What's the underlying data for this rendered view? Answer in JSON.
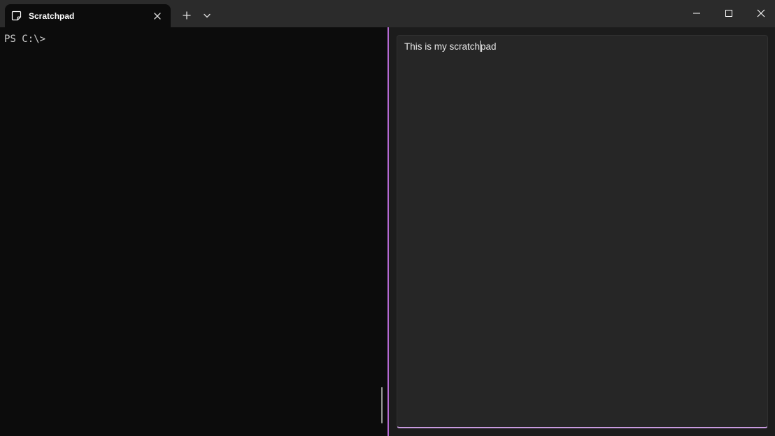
{
  "tab": {
    "title": "Scratchpad",
    "icon": "sticky-note-icon"
  },
  "toolbar": {
    "new_tab_icon": "plus-icon",
    "dropdown_icon": "chevron-down-icon"
  },
  "window_controls": {
    "minimize_icon": "minimize-icon",
    "maximize_icon": "maximize-icon",
    "close_icon": "close-icon"
  },
  "terminal": {
    "prompt": "PS C:\\>"
  },
  "scratchpad": {
    "text_before_caret": "This is my scratch",
    "text_after_caret": "pad"
  },
  "colors": {
    "titlebar_bg": "#2b2b2b",
    "terminal_bg": "#0c0c0c",
    "accent": "#b56ad4",
    "textbox_bg": "#262626"
  }
}
